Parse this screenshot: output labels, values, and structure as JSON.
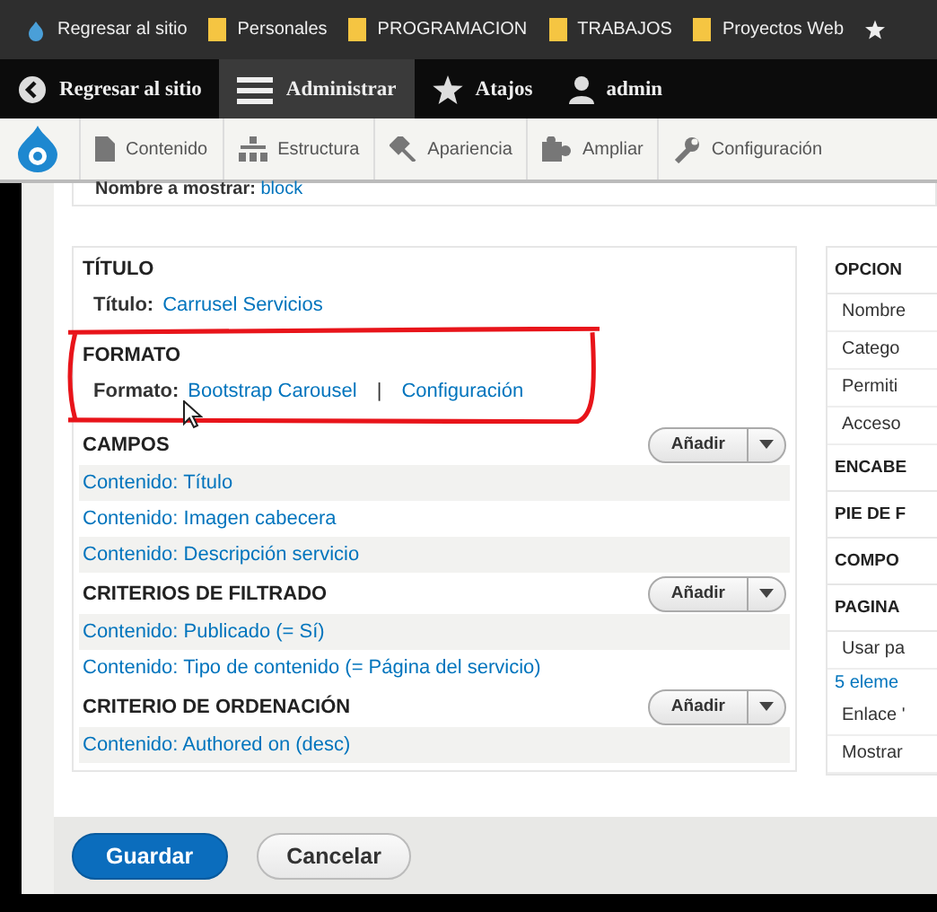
{
  "bookmarks": [
    {
      "label": "Regresar al sitio",
      "kind": "site"
    },
    {
      "label": "Personales",
      "kind": "folder"
    },
    {
      "label": "PROGRAMACION",
      "kind": "folder"
    },
    {
      "label": "TRABAJOS",
      "kind": "folder"
    },
    {
      "label": "Proyectos Web",
      "kind": "folder"
    },
    {
      "kind": "star"
    }
  ],
  "toolbar": [
    {
      "label": "Regresar al sitio",
      "kind": "back",
      "selected": false
    },
    {
      "label": "Administrar",
      "kind": "menu",
      "selected": true
    },
    {
      "label": "Atajos",
      "kind": "star",
      "selected": false
    },
    {
      "label": "admin",
      "kind": "user",
      "selected": false
    }
  ],
  "tray": [
    {
      "label": "Contenido",
      "kind": "content"
    },
    {
      "label": "Estructura",
      "kind": "structure"
    },
    {
      "label": "Apariencia",
      "kind": "appearance"
    },
    {
      "label": "Ampliar",
      "kind": "extend"
    },
    {
      "label": "Configuración",
      "kind": "config"
    }
  ],
  "display_name": {
    "label": "Nombre a mostrar:",
    "value": "block"
  },
  "sections": [
    {
      "title": "TÍTULO",
      "kind": "detail",
      "label": "Título:",
      "links": [
        "Carrusel Servicios"
      ]
    },
    {
      "title": "FORMATO",
      "kind": "detail",
      "label": "Formato:",
      "links": [
        "Bootstrap Carousel",
        "Configuración"
      ],
      "separator": "|",
      "annotated": true
    },
    {
      "title": "CAMPOS",
      "kind": "list",
      "add_button": "Añadir",
      "items": [
        "Contenido: Título",
        "Contenido: Imagen cabecera",
        "Contenido: Descripción servicio"
      ]
    },
    {
      "title": "CRITERIOS DE FILTRADO",
      "kind": "list",
      "add_button": "Añadir",
      "items": [
        "Contenido: Publicado (= Sí)",
        "Contenido: Tipo de contenido (= Página del servicio)"
      ]
    },
    {
      "title": "CRITERIO DE ORDENACIÓN",
      "kind": "list",
      "add_button": "Añadir",
      "items": [
        "Contenido: Authored on (desc)"
      ]
    }
  ],
  "side_panel": [
    {
      "label": "OPCION",
      "kind": "header"
    },
    {
      "label": "Nombre",
      "kind": "row"
    },
    {
      "label": "Catego",
      "kind": "row"
    },
    {
      "label": "Permiti",
      "kind": "row"
    },
    {
      "label": "Acceso",
      "kind": "row"
    },
    {
      "label": "ENCABE",
      "kind": "header"
    },
    {
      "label": "PIE DE F",
      "kind": "header"
    },
    {
      "label": "COMPO",
      "kind": "header"
    },
    {
      "label": "PAGINA",
      "kind": "header"
    },
    {
      "label": "Usar pa",
      "kind": "row"
    },
    {
      "label": "5 eleme",
      "kind": "link"
    },
    {
      "label": "Enlace '",
      "kind": "row"
    },
    {
      "label": "Mostrar",
      "kind": "row"
    }
  ],
  "actions": [
    {
      "label": "Guardar",
      "kind": "primary"
    },
    {
      "label": "Cancelar",
      "kind": "secondary"
    }
  ]
}
